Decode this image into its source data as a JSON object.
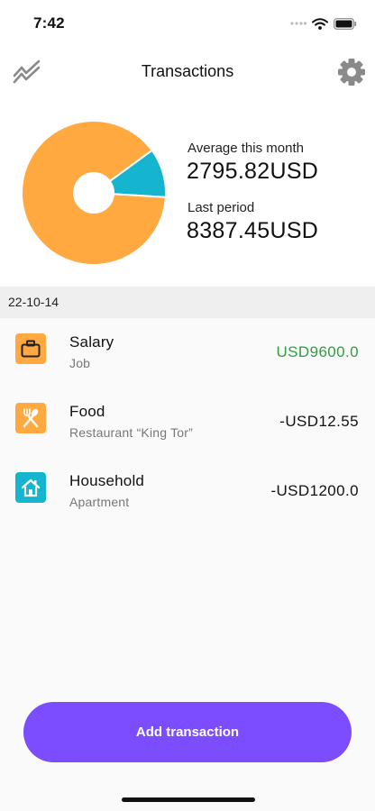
{
  "status_bar": {
    "time": "7:42"
  },
  "header": {
    "title": "Transactions",
    "left_icon": "trend-chart-icon",
    "right_icon": "gear-icon"
  },
  "summary": {
    "average_label": "Average this month",
    "average_value": "2795.82USD",
    "last_label": "Last period",
    "last_value": "8387.45USD"
  },
  "colors": {
    "accent": "#7c4dff",
    "income": "#2e9e3e",
    "orange": "#ffa940",
    "teal": "#15b5cf"
  },
  "chart_data": {
    "type": "pie",
    "values": [
      0.89,
      0.11
    ],
    "colors": [
      "#ffa940",
      "#15b5cf"
    ]
  },
  "date_group": "22-10-14",
  "transactions": [
    {
      "title": "Salary",
      "subtitle": "Job",
      "amount": "USD9600.0",
      "icon": "briefcase-icon",
      "icon_color": "#ffa940",
      "positive": true
    },
    {
      "title": "Food",
      "subtitle": "Restaurant “King Tor”",
      "amount": "-USD12.55",
      "icon": "utensils-icon",
      "icon_color": "#ffa940",
      "positive": false
    },
    {
      "title": "Household",
      "subtitle": "Apartment",
      "amount": "-USD1200.0",
      "icon": "house-icon",
      "icon_color": "#15b5cf",
      "positive": false
    }
  ],
  "add_button": {
    "label": "Add transaction"
  }
}
